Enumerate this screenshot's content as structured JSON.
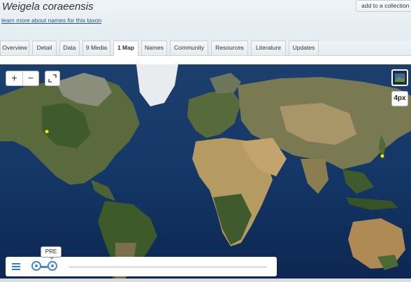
{
  "header": {
    "title": "Weigela coraeensis",
    "learn_link": "learn more about names for this taxon",
    "collect_button": "add to a collection"
  },
  "tabs": [
    {
      "label": "Overview",
      "active": false
    },
    {
      "label": "Detail",
      "active": false
    },
    {
      "label": "Data",
      "active": false
    },
    {
      "label": "9 Media",
      "active": false
    },
    {
      "label": "1 Map",
      "active": true
    },
    {
      "label": "Names",
      "active": false
    },
    {
      "label": "Community",
      "active": false
    },
    {
      "label": "Resources",
      "active": false
    },
    {
      "label": "Literature",
      "active": false
    },
    {
      "label": "Updates",
      "active": false
    }
  ],
  "map": {
    "zoom_in": "+",
    "zoom_out": "−",
    "layer_badge": "4px",
    "timeline_label": "PRE",
    "icons": [
      "zoom-in-icon",
      "zoom-out-icon",
      "fullscreen-icon",
      "layer-switcher-icon",
      "menu-icon"
    ],
    "colors": {
      "ocean": "#0d2a52",
      "occurrence": "#f2e600",
      "slider": "#4a86c6"
    }
  }
}
